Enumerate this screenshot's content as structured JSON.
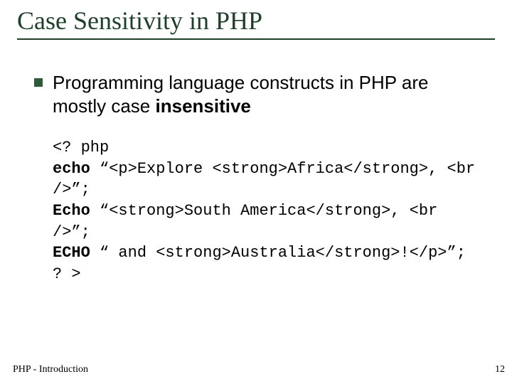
{
  "title": "Case Sensitivity in PHP",
  "bullet": {
    "pre": "Programming language constructs in PHP are mostly case ",
    "bold": "insensitive"
  },
  "code": {
    "l1": "<? php",
    "l2a": "echo",
    "l2b": " “<p>Explore <strong>Africa</strong>, <br",
    "l3": "/>”;",
    "l4a": "Echo",
    "l4b": " “<strong>South America</strong>, <br />”;",
    "l5a": "ECHO",
    "l5b": " “ and <strong>Australia</strong>!</p>”;",
    "l6": "? >"
  },
  "footer": {
    "left": "PHP - Introduction",
    "right": "12"
  }
}
